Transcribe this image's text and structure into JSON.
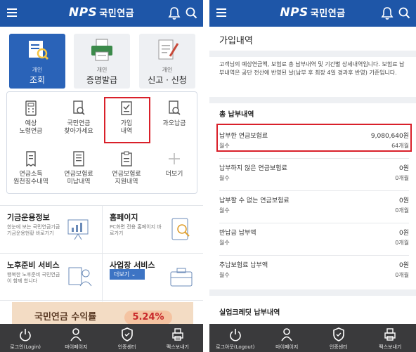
{
  "brand": {
    "logo_nps": "NPS",
    "logo_kor": "국민연금"
  },
  "left": {
    "categories": [
      {
        "small": "개인",
        "big": "조회"
      },
      {
        "small": "개인",
        "big": "증명발급"
      },
      {
        "small": "개인",
        "big": "신고 · 신청"
      }
    ],
    "grid": [
      {
        "l1": "예상",
        "l2": "노령연금"
      },
      {
        "l1": "국민연금",
        "l2": "찾아가세요"
      },
      {
        "l1": "가입",
        "l2": "내역"
      },
      {
        "l1": "과오납금",
        "l2": ""
      },
      {
        "l1": "연금소득",
        "l2": "원천징수내역"
      },
      {
        "l1": "연금보험료",
        "l2": "미납내역"
      },
      {
        "l1": "연금보험료",
        "l2": "지원내역"
      },
      {
        "l1": "더보기",
        "l2": ""
      }
    ],
    "info": [
      {
        "title": "기금운용정보",
        "sub": "한눈에 보는 국민연금기금 기금운용현황 바로가기"
      },
      {
        "title": "홈페이지",
        "sub": "PC화면 전용 홈페이지 바로가기"
      },
      {
        "title": "노후준비 서비스",
        "sub": "행복한 노후준비 국민연금이 함께 합니다"
      },
      {
        "title": "사업장 서비스",
        "more": "더보기"
      }
    ],
    "banner": {
      "text": "국민연금 수익률",
      "value": "5.24%"
    }
  },
  "right": {
    "title": "가입내역",
    "desc": "고객님의 예상연금액, 보험료 총 납부내역 및 기간별 상세내역입니다. 보험료 납부내역은 공단 전산에 반영된 날(납부 후 최장 4일 경과후 반영) 기준입니다.",
    "section_total": "총 납부내역",
    "rows": [
      {
        "label": "납부한 연금보험료",
        "value": "9,080,640원",
        "mlabel": "월수",
        "mvalue": "64개월"
      },
      {
        "label": "납부하지 않은 연금보험료",
        "value": "0원",
        "mlabel": "월수",
        "mvalue": "0개월"
      },
      {
        "label": "납부할 수 없는 연금보험료",
        "value": "0원",
        "mlabel": "월수",
        "mvalue": "0개월"
      },
      {
        "label": "반납금 납부액",
        "value": "0원",
        "mlabel": "월수",
        "mvalue": "0개월"
      },
      {
        "label": "추납보험료 납부액",
        "value": "0원",
        "mlabel": "월수",
        "mvalue": "0개월"
      }
    ],
    "section_unemp": "실업크레딧 납부내역"
  },
  "bottom_left": [
    "로그인(Login)",
    "마이페이지",
    "인증센터",
    "팩스보내기"
  ],
  "bottom_right": [
    "로그아웃(Logout)",
    "마이페이지",
    "인증센터",
    "팩스보내기"
  ],
  "colors": {
    "brand_blue": "#1e56a8",
    "highlight_red": "#d9202a",
    "bottom_bar": "#3a3a3c"
  }
}
